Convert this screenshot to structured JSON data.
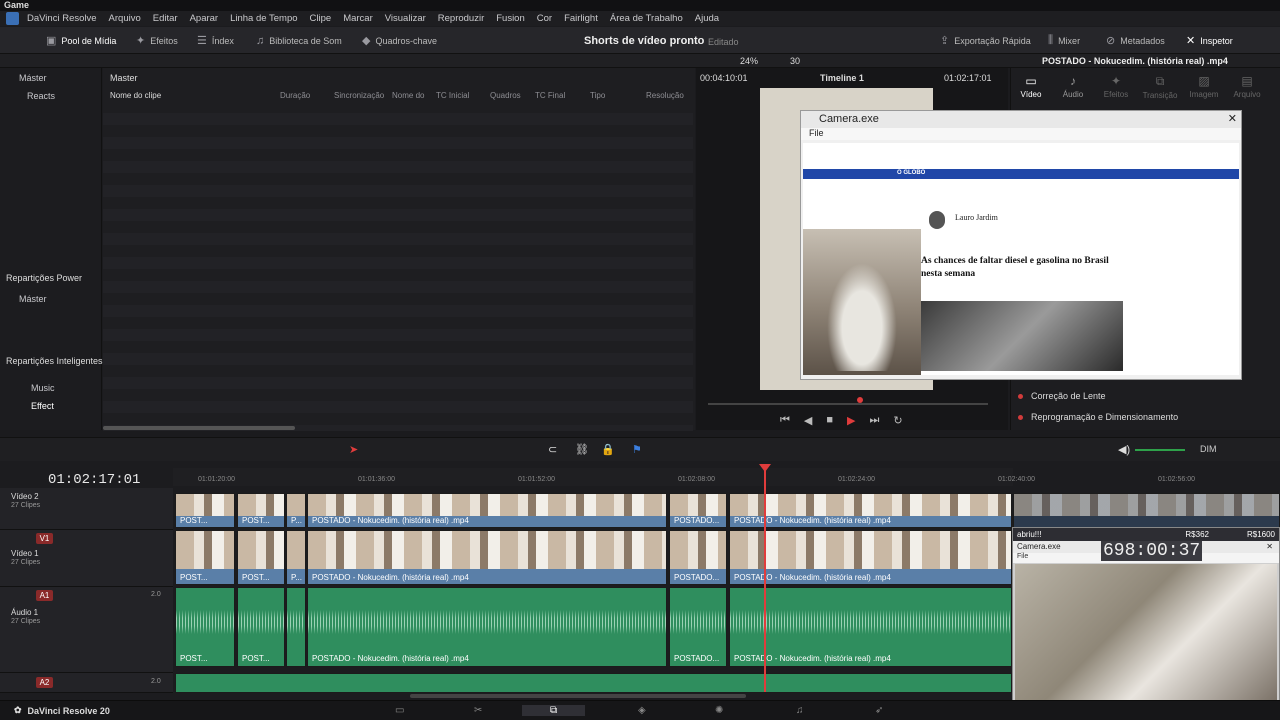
{
  "window": {
    "title": "Game",
    "controls": [
      "–",
      "▢",
      "✕"
    ]
  },
  "menu": [
    "DaVinci Resolve",
    "Arquivo",
    "Editar",
    "Aparar",
    "Linha de Tempo",
    "Clipe",
    "Marcar",
    "Visualizar",
    "Reproduzir",
    "Fusion",
    "Cor",
    "Fairlight",
    "Área de Trabalho",
    "Ajuda"
  ],
  "toolbar": {
    "media_pool": "Pool de Mídia",
    "effects": "Efeitos",
    "index": "Índex",
    "sound_lib": "Biblioteca de Som",
    "keyframes": "Quadros-chave",
    "project": "Shorts de vídeo pronto",
    "status": "Editado",
    "quick_export": "Exportação Rápida",
    "mixer": "Mixer",
    "metadata": "Metadados",
    "inspector": "Inspetor"
  },
  "subbar": {
    "zoom": "24%",
    "fps": "30",
    "timecode_left": "00:04:10:01",
    "timeline_name": "Timeline 1",
    "timecode_right": "01:02:17:01",
    "clip_name": "POSTADO - Nokucedim. (história real) .mp4"
  },
  "bins": {
    "master": "Máster",
    "reacts": "Reacts",
    "power_bins": "Repartições Power",
    "power_master": "Máster",
    "smart_bins": "Repartições Inteligentes",
    "music": "Music",
    "effect": "Effect"
  },
  "clips_panel": {
    "header": "Master",
    "columns": [
      "Nome do clipe",
      "Duração",
      "Sincronização",
      "Nome do F",
      "TC Inicial",
      "Quadros",
      "TC Final",
      "Tipo",
      "Resolução"
    ]
  },
  "inspector": {
    "tabs": [
      "Vídeo",
      "Áudio",
      "Efeitos",
      "Transição",
      "Imagem",
      "Arquivo"
    ],
    "rows": [
      "Correção de Lente",
      "Reprogramação e Dimensionamento"
    ]
  },
  "camera1": {
    "title": "Camera.exe",
    "menu": "File",
    "article": {
      "author": "Lauro Jardim",
      "headline": "As chances de faltar diesel e gasolina no Brasil nesta semana",
      "site": "O GLOBO"
    }
  },
  "timeline": {
    "timecode": "01:02:17:01",
    "ruler": [
      "01:01:20:00",
      "01:01:36:00",
      "01:01:52:00",
      "01:02:08:00",
      "01:02:24:00",
      "01:02:40:00",
      "01:02:56:00"
    ],
    "tracks": {
      "v2": {
        "name": "Vídeo 2",
        "count": "27 Clipes"
      },
      "v1": {
        "id": "V1",
        "name": "Vídeo 1",
        "count": "27 Clipes"
      },
      "a1": {
        "id": "A1",
        "name": "Áudio 1",
        "count": "27 Clipes",
        "gain": "2.0"
      },
      "a2": {
        "id": "A2",
        "gain": "2.0"
      }
    },
    "clip_short": "POST...",
    "clip_tiny": "P...",
    "clip_long": "POSTADO - Nokucedim. (história real) .mp4",
    "clip_med": "POSTADO...",
    "dim": "DIM"
  },
  "camera2": {
    "label": "abriu!!!",
    "val1": "R$362",
    "val2": "R$1600",
    "title": "Camera.exe",
    "sub": "File",
    "timer": "698:00:37"
  },
  "status": {
    "brand": "DaVinci Resolve 20"
  }
}
